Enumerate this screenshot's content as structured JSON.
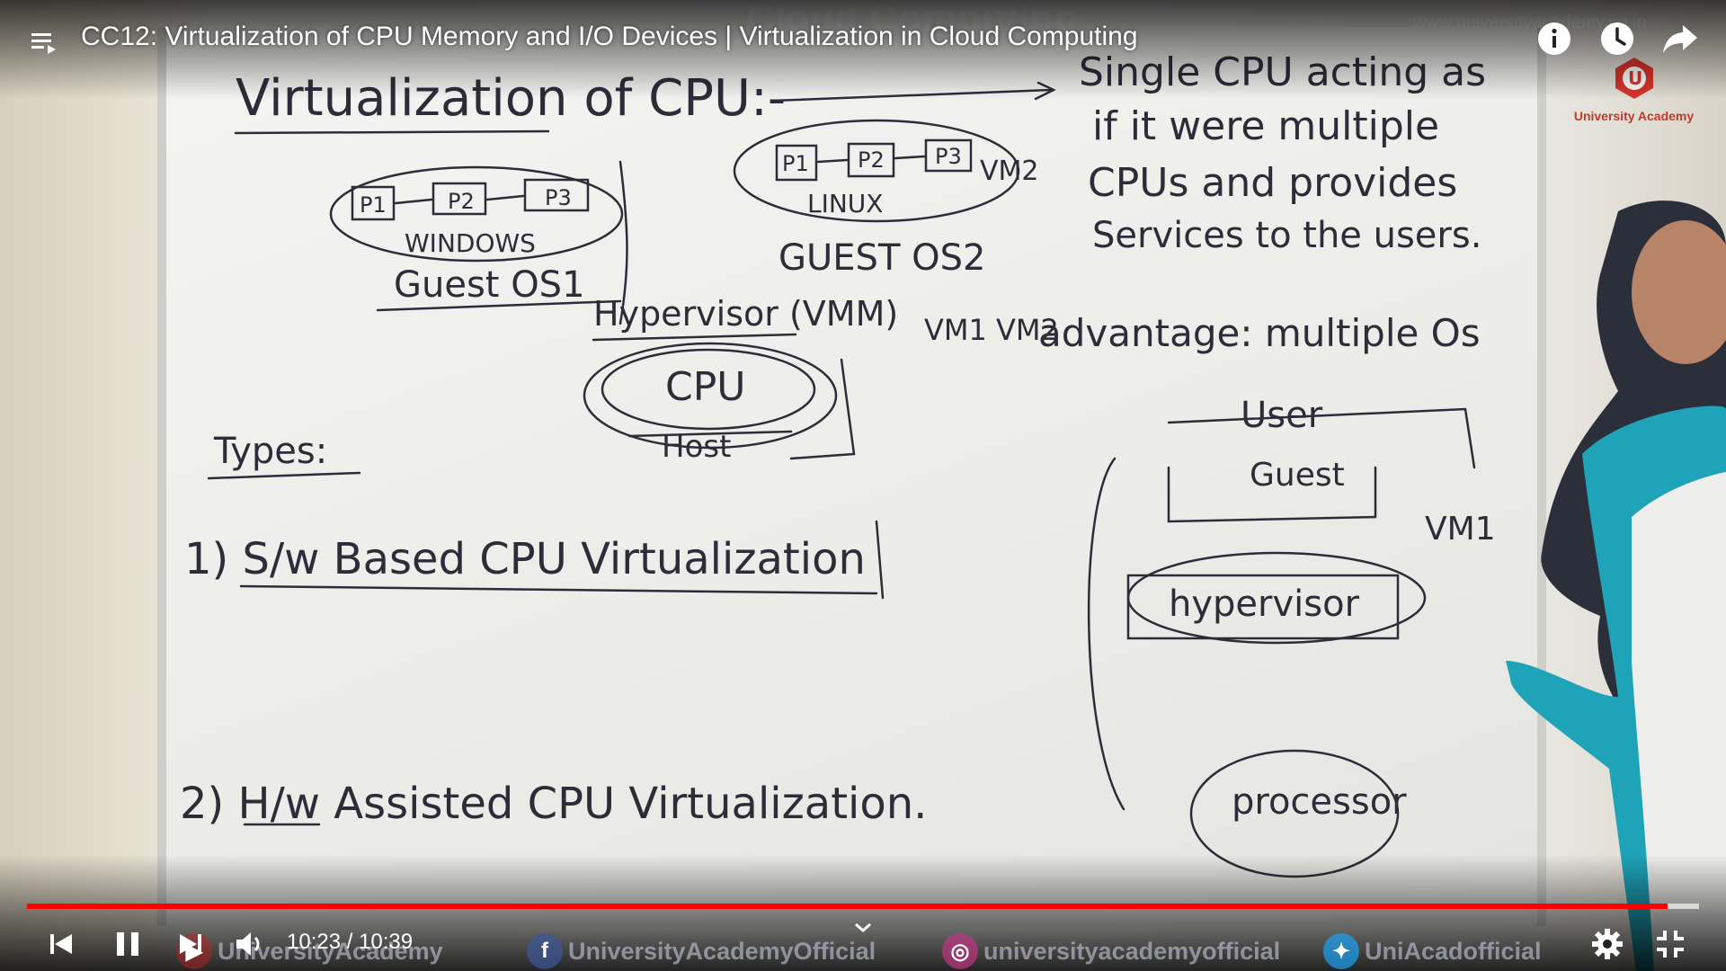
{
  "player": {
    "title": "CC12: Virtualization of CPU Memory and I/O Devices | Virtualization in Cloud Computing",
    "current_time": "10:23",
    "duration": "10:39",
    "time_text": "10:23 / 10:39",
    "progress_fraction": 0.981,
    "loaded_fraction": 1.0,
    "accent_color": "#ff0000",
    "top_icons": [
      "playlist-icon",
      "info-icon",
      "watch-later-icon",
      "share-icon"
    ],
    "bottom_icons": [
      "previous-icon",
      "pause-icon",
      "next-icon",
      "volume-icon",
      "chevron-down-icon",
      "settings-icon",
      "exit-fullscreen-icon"
    ]
  },
  "overlay": {
    "watermark_title": "Cloud Computing",
    "watermark_url": "www.universityacademy.co.in",
    "logo_text": "University Academy",
    "logo_letter": "U"
  },
  "social": {
    "youtube": "UniversityAcademy",
    "facebook": "UniversityAcademyOfficial",
    "instagram": "universityacademyofficial",
    "twitter": "UniAcadofficial"
  },
  "whiteboard": {
    "heading": "Virtualization of CPU:-",
    "definition_lines": [
      "Single CPU acting as",
      "if it were multiple",
      "CPUs and provides",
      "Services to the users."
    ],
    "guest_os1_processes": [
      "P1",
      "P2",
      "P3"
    ],
    "guest_os1_name": "WINDOWS",
    "guest_os1_label": "Guest OS1",
    "guest_os2_processes": [
      "P1",
      "P2",
      "P3"
    ],
    "guest_os2_name": "LINUX",
    "guest_os2_label": "GUEST OS2",
    "vm2_tag": "VM2",
    "hypervisor_label": "Hypervisor (VMM)",
    "vm_list": "VM1 VM2",
    "cpu_label": "CPU",
    "host_label": "Host",
    "advantage": "advantage: multiple Os",
    "types_heading": "Types:",
    "type1": "1) S/w Based CPU Virtualization",
    "type2": "2) H/w Assisted CPU Virtualization.",
    "right_diagram_user": "User",
    "right_diagram_guest": "Guest",
    "right_diagram_hypervisor": "hypervisor",
    "right_diagram_processor": "processor",
    "right_diagram_vm": "VM1"
  }
}
